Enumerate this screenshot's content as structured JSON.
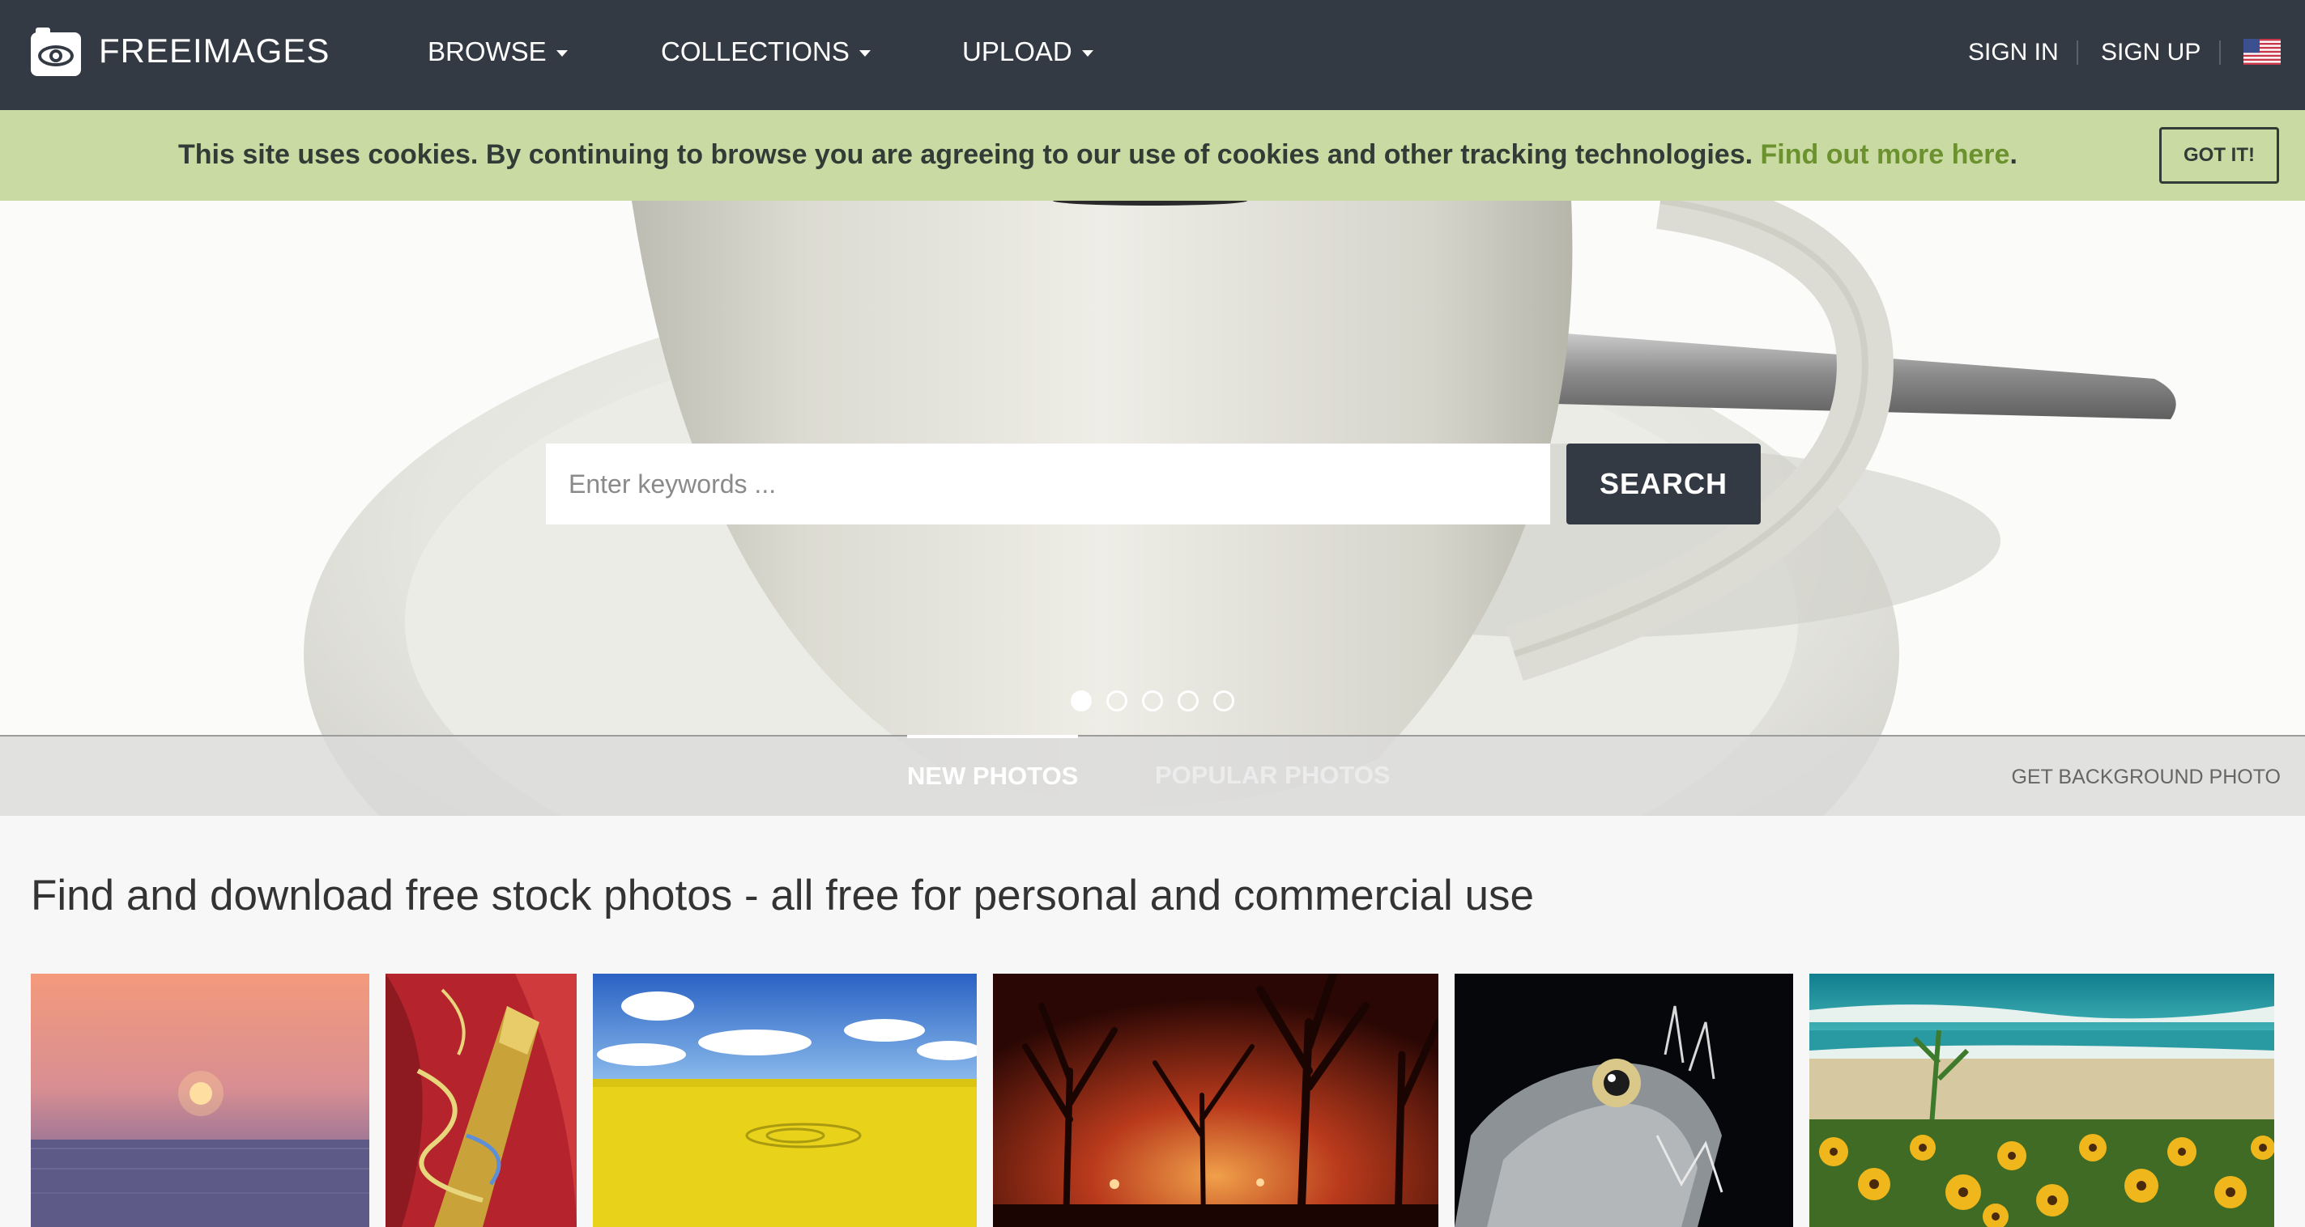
{
  "brand": {
    "name": "FREEIMAGES",
    "logo_icon": "camera-eye-icon"
  },
  "nav": {
    "items": [
      {
        "label": "BROWSE",
        "icon": "caret-down-icon"
      },
      {
        "label": "COLLECTIONS",
        "icon": "caret-down-icon"
      },
      {
        "label": "UPLOAD",
        "icon": "caret-down-icon"
      }
    ],
    "sign_in": "SIGN IN",
    "sign_up": "SIGN UP",
    "language_icon": "us-flag-icon"
  },
  "cookie_banner": {
    "text": "This site uses cookies. By continuing to browse you are agreeing to our use of cookies and other tracking technologies.",
    "link": "Find out more here",
    "suffix": ".",
    "button": "GOT IT!"
  },
  "hero": {
    "search_placeholder": "Enter keywords ...",
    "search_button": "SEARCH",
    "slides_total": 5,
    "active_slide": 1
  },
  "tabs": {
    "items": [
      {
        "label": "NEW PHOTOS",
        "active": true
      },
      {
        "label": "POPULAR PHOTOS",
        "active": false
      }
    ],
    "background_link": "GET BACKGROUND PHOTO"
  },
  "main": {
    "heading": "Find and download free stock photos - all free for personal and commercial use"
  },
  "photos": [
    {
      "subject": "sunset over sea"
    },
    {
      "subject": "champagne bottle with streamers"
    },
    {
      "subject": "yellow rapeseed field with crop circle"
    },
    {
      "subject": "foggy trees at night with lights"
    },
    {
      "subject": "deep sea fish"
    },
    {
      "subject": "yellow flowers at beach"
    }
  ],
  "colors": {
    "navbar": "#343a44",
    "cookie_bar": "#c9dba2",
    "cookie_link": "#6c9230",
    "search_button": "#343a44"
  }
}
